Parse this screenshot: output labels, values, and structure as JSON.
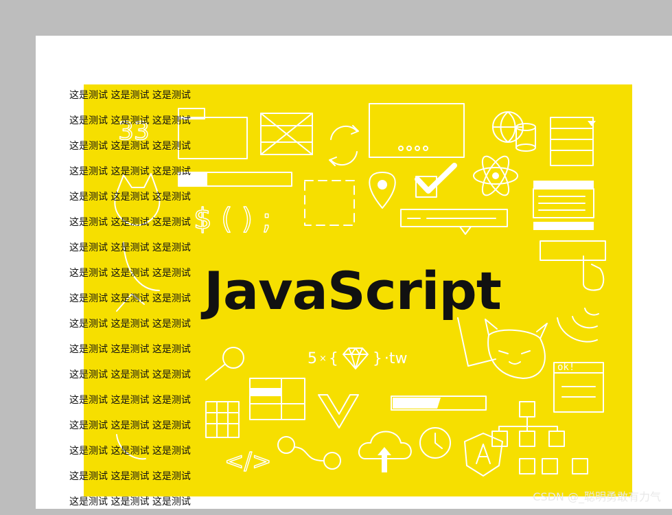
{
  "banner": {
    "title": "JavaScript",
    "sub_logo": {
      "prefix": "5",
      "times": "×",
      "left_brace": "{",
      "right_brace": "}",
      "suffix": "·tw"
    },
    "badge_text": "ok!",
    "colors": {
      "background": "#f6df00",
      "lines": "#ffffff",
      "title": "#111111"
    }
  },
  "lines": [
    "这是测试 这是测试 这是测试",
    "这是测试 这是测试 这是测试",
    "这是测试 这是测试 这是测试",
    "这是测试 这是测试 这是测试",
    "这是测试 这是测试 这是测试",
    "这是测试 这是测试 这是测试",
    "这是测试 这是测试 这是测试",
    "这是测试 这是测试 这是测试",
    "这是测试 这是测试 这是测试",
    "这是测试 这是测试 这是测试",
    "这是测试 这是测试 这是测试",
    "这是测试 这是测试 这是测试",
    "这是测试 这是测试 这是测试",
    "这是测试 这是测试 这是测试",
    "这是测试 这是测试 这是测试",
    "这是测试 这是测试 这是测试",
    "这是测试 这是测试 这是测试"
  ],
  "watermark": "CSDN @_聪明勇敢有力气"
}
